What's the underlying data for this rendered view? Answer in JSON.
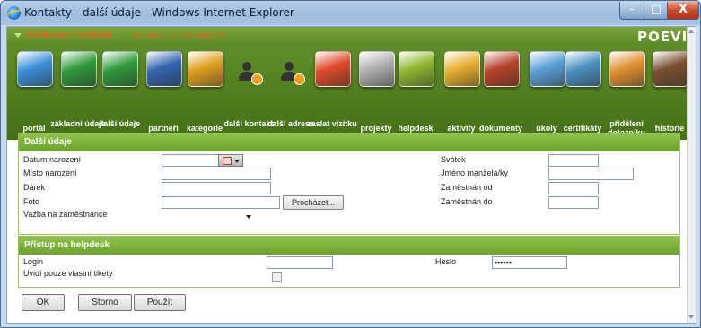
{
  "window": {
    "title": "Kontakty - další údaje - Windows Internet Explorer",
    "minimize_glyph": "–",
    "maximize_glyph": "□",
    "close_glyph": "X"
  },
  "header": {
    "contact_name": "Zvrškovec František",
    "company": "Homolo, s.r.o. / Prodejna ČR",
    "logo_text": "POEVI"
  },
  "toolbar": {
    "items": [
      {
        "label": "portál",
        "icon": "globe-icon",
        "color": "#3a8fd8"
      },
      {
        "label": "základní údaje",
        "icon": "person-card-icon",
        "color": "#2f9a3a"
      },
      {
        "label": "další údaje",
        "icon": "person-card-icon",
        "color": "#2f9a3a"
      },
      {
        "label": "partneři",
        "icon": "factory-icon",
        "color": "#3264b0"
      },
      {
        "label": "kategorie",
        "icon": "binders-icon",
        "color": "#e0a020"
      },
      {
        "label": "další kontakt",
        "icon": "add-person-icon",
        "color": "#444444"
      },
      {
        "label": "další adresa",
        "icon": "add-person-icon",
        "color": "#444444"
      },
      {
        "label": "zaslat vizitku",
        "icon": "email-export-icon",
        "color": "#e04a2a"
      },
      {
        "label": "projekty",
        "icon": "cabinet-icon",
        "color": "#b0b0b0"
      },
      {
        "label": "helpdesk",
        "icon": "hd-gear-icon",
        "color": "#8fb830"
      },
      {
        "label": "aktivity",
        "icon": "calendar-icon",
        "color": "#e8b030"
      },
      {
        "label": "dokumenty",
        "icon": "folder-icon",
        "color": "#b8422a"
      },
      {
        "label": "úkoly",
        "icon": "checklist-icon",
        "color": "#5aa0d8"
      },
      {
        "label": "certifikáty",
        "icon": "certificate-icon",
        "color": "#4a90c0"
      },
      {
        "label": "přidělení dotazníku",
        "icon": "questionnaire-icon",
        "color": "#e09030"
      },
      {
        "label": "historie",
        "icon": "books-icon",
        "color": "#7a5030"
      }
    ]
  },
  "section_details": {
    "title": "Další údaje",
    "left_fields": [
      {
        "label": "Datum narození",
        "value": ""
      },
      {
        "label": "Místo narození",
        "value": ""
      },
      {
        "label": "Dárek",
        "value": ""
      },
      {
        "label": "Foto",
        "value": ""
      },
      {
        "label": "Vazba na zaměstnance",
        "value": ""
      }
    ],
    "browse_label": "Procházet...",
    "right_fields": [
      {
        "label": "Svátek",
        "value": ""
      },
      {
        "label": "Jméno manžela/ky",
        "value": ""
      },
      {
        "label": "Zaměstnán od",
        "value": ""
      },
      {
        "label": "Zaměstnán do",
        "value": ""
      }
    ]
  },
  "section_helpdesk": {
    "title": "Přístup na helpdesk",
    "login_label": "Login",
    "login_value": "",
    "password_label": "Heslo",
    "password_value": "••••••",
    "own_tickets_label": "Uvidí pouze vlastní tikety"
  },
  "buttons": {
    "ok": "OK",
    "cancel": "Storno",
    "apply": "Použít"
  }
}
